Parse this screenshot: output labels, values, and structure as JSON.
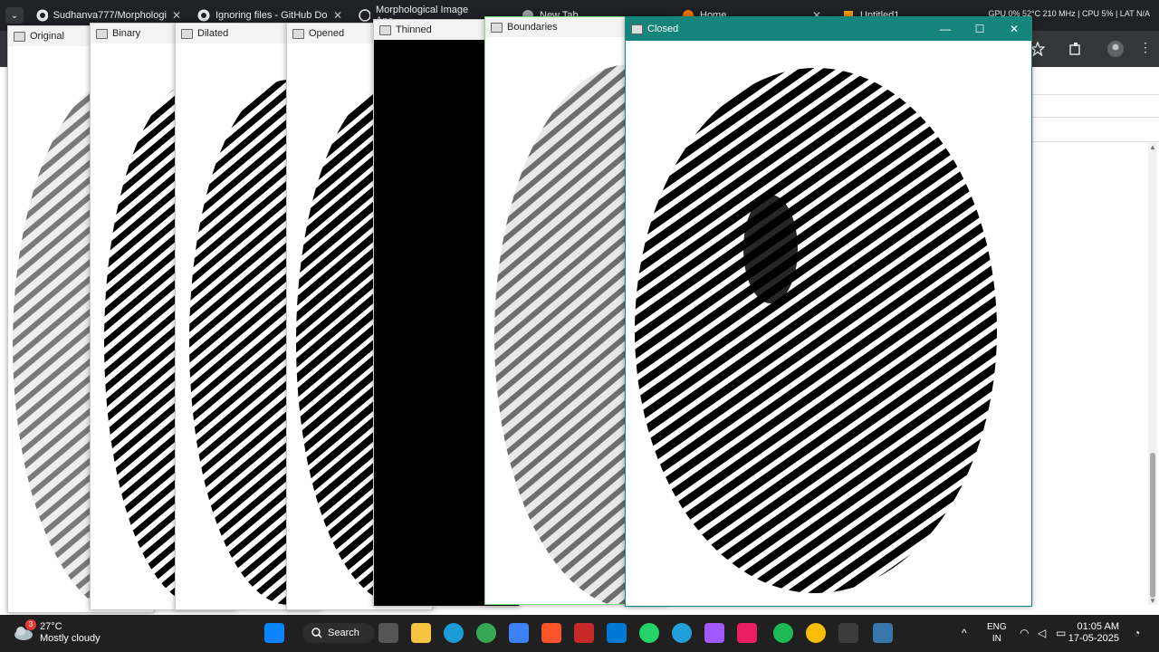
{
  "browser": {
    "tabs": [
      {
        "title": "Sudhanva777/Morphologi",
        "icon": "github-icon"
      },
      {
        "title": "Ignoring files - GitHub Do",
        "icon": "github-icon"
      },
      {
        "title": "Morphological Image Ana",
        "icon": "chatgpt-icon"
      },
      {
        "title": "New Tab",
        "icon": "chrome-icon"
      },
      {
        "title": "Home",
        "icon": "app-icon"
      },
      {
        "title": "Untitled1",
        "icon": "app-icon"
      }
    ],
    "close_glyph": "✕",
    "dropdown_glyph": "⌄",
    "system_monitor": "GPU 0% 52°C 210 MHz  |  CPU 5%  |  LAT N/A"
  },
  "windows": [
    {
      "title": "Original"
    },
    {
      "title": "Binary"
    },
    {
      "title": "Dilated"
    },
    {
      "title": "Opened"
    },
    {
      "title": "Thinned"
    },
    {
      "title": "Boundaries"
    },
    {
      "title": "Closed"
    }
  ],
  "closed_window_controls": {
    "minimize": "—",
    "maximize": "☐",
    "close": "✕"
  },
  "taskbar": {
    "weather_temp": "27°C",
    "weather_desc": "Mostly cloudy",
    "weather_badge": "3",
    "search_label": "Search",
    "lang_line1": "ENG",
    "lang_line2": "IN",
    "time": "01:05 AM",
    "date": "17-05-2025",
    "chevron": "^"
  },
  "colors": {
    "active_title": "#15847a",
    "taskbar": "#202020",
    "tabbar": "#202124"
  }
}
